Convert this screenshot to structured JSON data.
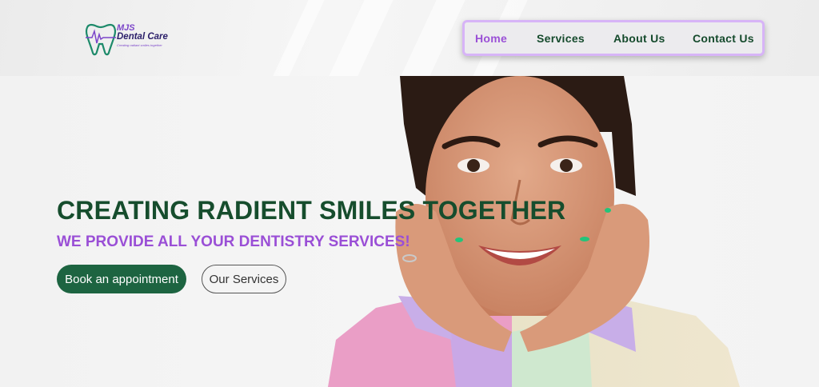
{
  "brand": {
    "name_top": "MJS",
    "name_main": "Dental Care",
    "tagline": "Creating radiant smiles together",
    "logo_icon": "tooth-heartbeat-icon",
    "colors": {
      "green": "#1d6441",
      "purple": "#9a4fd6",
      "dark_green": "#164d2d"
    }
  },
  "nav": {
    "items": [
      {
        "label": "Home",
        "active": true
      },
      {
        "label": "Services",
        "active": false
      },
      {
        "label": "About Us",
        "active": false
      },
      {
        "label": "Contact Us",
        "active": false
      }
    ]
  },
  "hero": {
    "headline": "CREATING RADIENT SMILES TOGETHER",
    "subheadline": "WE PROVIDE ALL YOUR DENTISTRY SERVICES!",
    "primary_button": "Book an appointment",
    "secondary_button": "Our Services",
    "image": "smiling-woman-photo"
  }
}
